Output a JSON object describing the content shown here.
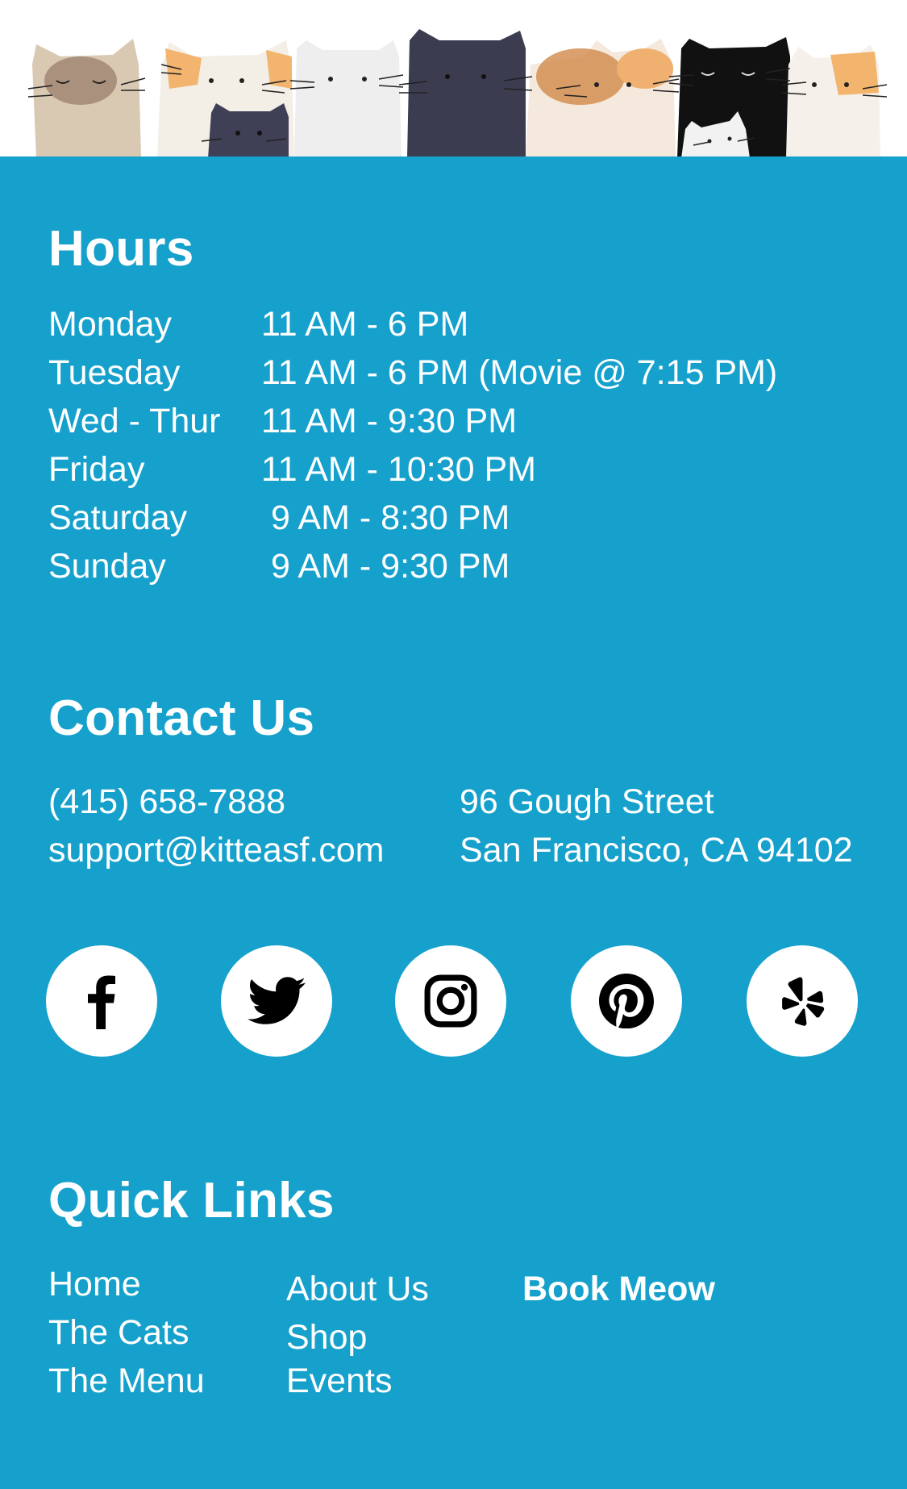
{
  "hours": {
    "title": "Hours",
    "rows": [
      {
        "day": "Monday",
        "time": "11 AM - 6 PM"
      },
      {
        "day": "Tuesday",
        "time": "11 AM - 6 PM (Movie @ 7:15 PM)"
      },
      {
        "day": "Wed - Thur",
        "time": "11 AM - 9:30 PM"
      },
      {
        "day": "Friday",
        "time": "11 AM - 10:30 PM"
      },
      {
        "day": "Saturday",
        "time": " 9 AM - 8:30 PM"
      },
      {
        "day": "Sunday",
        "time": " 9 AM - 9:30 PM"
      }
    ]
  },
  "contact": {
    "title": "Contact Us",
    "phone": "(415) 658-7888",
    "email": "support@kitteasf.com",
    "street": "96 Gough Street",
    "city": "San Francisco, CA 94102"
  },
  "social": [
    {
      "name": "facebook-icon"
    },
    {
      "name": "twitter-icon"
    },
    {
      "name": "instagram-icon"
    },
    {
      "name": "pinterest-icon"
    },
    {
      "name": "yelp-icon"
    }
  ],
  "quick_links": {
    "title": "Quick Links",
    "col1": [
      "Home",
      "The Cats",
      "The Menu"
    ],
    "col2": [
      "About Us",
      "Shop",
      "Events"
    ],
    "col3": [
      "Book Meow"
    ]
  },
  "colors": {
    "panel": "#16a1cc",
    "text": "#ffffff",
    "icon": "#000000"
  }
}
